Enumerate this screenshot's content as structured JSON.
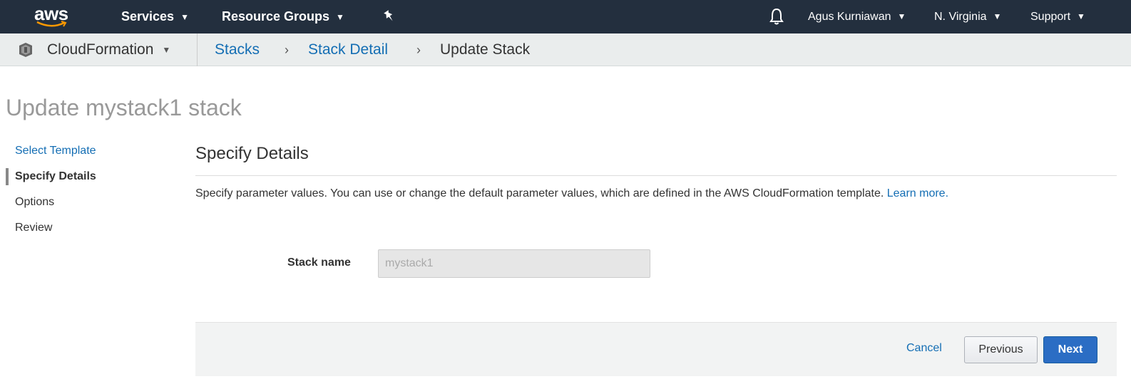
{
  "topnav": {
    "logo_text": "aws",
    "services_label": "Services",
    "resource_groups_label": "Resource Groups",
    "user_label": "Agus Kurniawan",
    "region_label": "N. Virginia",
    "support_label": "Support",
    "caret_glyph": "▼",
    "icons": [
      "aws-logo",
      "pin-icon",
      "bell-icon"
    ]
  },
  "breadcrumb": {
    "service_label": "CloudFormation",
    "items": [
      {
        "label": "Stacks"
      },
      {
        "label": "Stack Detail"
      },
      {
        "label": "Update Stack"
      }
    ],
    "separator": "›"
  },
  "page": {
    "title": "Update mystack1 stack"
  },
  "wizard": {
    "steps": [
      {
        "label": "Select Template"
      },
      {
        "label": "Specify Details"
      },
      {
        "label": "Options"
      },
      {
        "label": "Review"
      }
    ]
  },
  "section": {
    "title": "Specify Details",
    "description": "Specify parameter values. You can use or change the default parameter values, which are defined in the AWS CloudFormation template.",
    "learn_more": "Learn more."
  },
  "form": {
    "stack_name_label": "Stack name",
    "stack_name_value": "mystack1"
  },
  "actions": {
    "cancel_label": "Cancel",
    "previous_label": "Previous",
    "next_label": "Next"
  },
  "colors": {
    "nav_bg": "#232f3e",
    "link": "#146eb4",
    "primary_button": "#2b6dc4",
    "crumb_bar": "#eaeded"
  }
}
